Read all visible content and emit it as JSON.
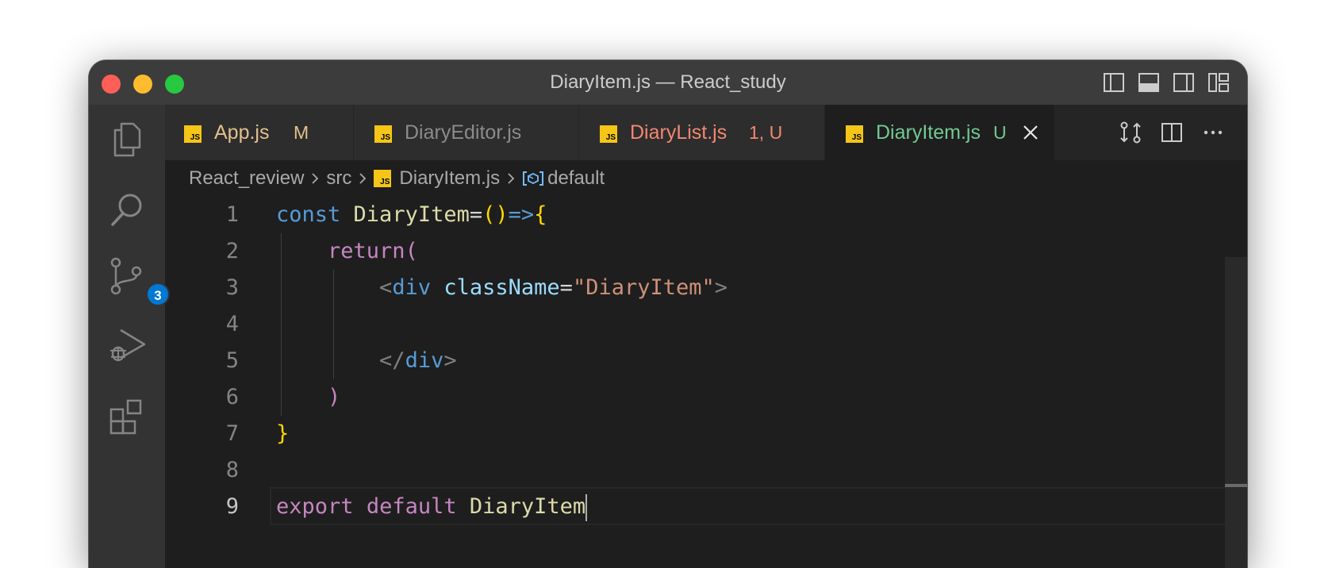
{
  "window": {
    "title": "DiaryItem.js — React_study"
  },
  "activity_bar": {
    "items": [
      {
        "name": "explorer",
        "icon": "files-icon"
      },
      {
        "name": "search",
        "icon": "search-icon"
      },
      {
        "name": "source-control",
        "icon": "source-control-icon",
        "badge": "3"
      },
      {
        "name": "run-debug",
        "icon": "run-debug-icon"
      },
      {
        "name": "extensions",
        "icon": "extensions-icon"
      }
    ]
  },
  "tabs": [
    {
      "label": "App.js",
      "mark": "M",
      "color": "#e2c08d",
      "active": false
    },
    {
      "label": "DiaryEditor.js",
      "mark": "",
      "color": "#8b8b8b",
      "active": false
    },
    {
      "label": "DiaryList.js",
      "mark": "1, U",
      "color": "#f48771",
      "active": false
    },
    {
      "label": "DiaryItem.js",
      "mark": "U",
      "color": "#73c991",
      "active": true
    }
  ],
  "breadcrumb": {
    "folder": "React_review",
    "subfolder": "src",
    "file": "DiaryItem.js",
    "symbol": "default"
  },
  "editor": {
    "line_numbers": [
      "1",
      "2",
      "3",
      "4",
      "5",
      "6",
      "7",
      "8",
      "9"
    ],
    "current_line": "9",
    "code": {
      "l1_const": "const",
      "l1_name": "DiaryItem",
      "l1_eq": "=",
      "l1_parens": "()",
      "l1_arrow": "=>",
      "l1_brace": "{",
      "l2_return": "return(",
      "l3_open": "<",
      "l3_tag": "div",
      "l3_attr": "className",
      "l3_eq": "=",
      "l3_str": "\"DiaryItem\"",
      "l3_close": ">",
      "l5_open": "</",
      "l5_tag": "div",
      "l5_close": ">",
      "l6_paren": ")",
      "l7_brace": "}",
      "l9_export": "export",
      "l9_default": "default",
      "l9_name": "DiaryItem"
    }
  },
  "colors": {
    "accent": "#0078d4",
    "modified": "#e2c08d",
    "error": "#f48771",
    "untracked": "#73c991"
  }
}
